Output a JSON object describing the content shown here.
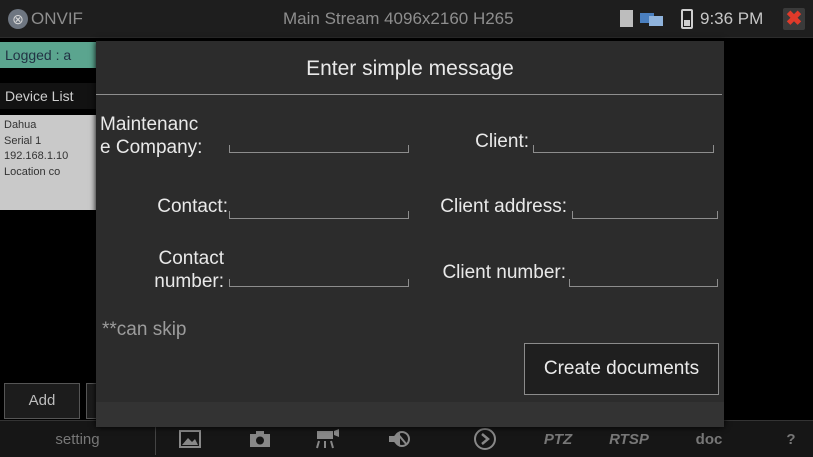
{
  "topbar": {
    "app_title": "ONVIF",
    "stream_title": "Main Stream 4096x2160 H265",
    "time": "9:36 PM",
    "close_glyph": "✖",
    "icons": [
      "onvif-icon",
      "sd-card-icon",
      "network-icon",
      "battery-icon",
      "close-icon"
    ]
  },
  "background": {
    "logged_text": "Logged : a",
    "device_list_label": "Device List",
    "device": {
      "name": "Dahua",
      "serial": "Serial 1",
      "ip": "192.168.1.10",
      "location": "Location co"
    },
    "add_label": "Add"
  },
  "dialog": {
    "title": "Enter simple message",
    "fields": {
      "maintenance_company_line1": "Maintenanc",
      "maintenance_company_line2": "e Company:",
      "client": "Client:",
      "contact": "Contact:",
      "client_address": "Client address:",
      "contact_number_line1": "Contact",
      "contact_number_line2": "number:",
      "client_number": "Client number:"
    },
    "hint": "**can skip",
    "create_button": "Create documents"
  },
  "toolbar": {
    "setting": "setting",
    "ptz": "PTZ",
    "rtsp": "RTSP",
    "doc": "doc",
    "help": "?",
    "icons": [
      "gallery-icon",
      "camera-icon",
      "record-icon",
      "audio-mute-icon",
      "play-icon"
    ]
  },
  "colors": {
    "logged_bg": "#5ba58f",
    "close_red": "#e03a2a",
    "dialog_bg": "#2c2c2c"
  }
}
